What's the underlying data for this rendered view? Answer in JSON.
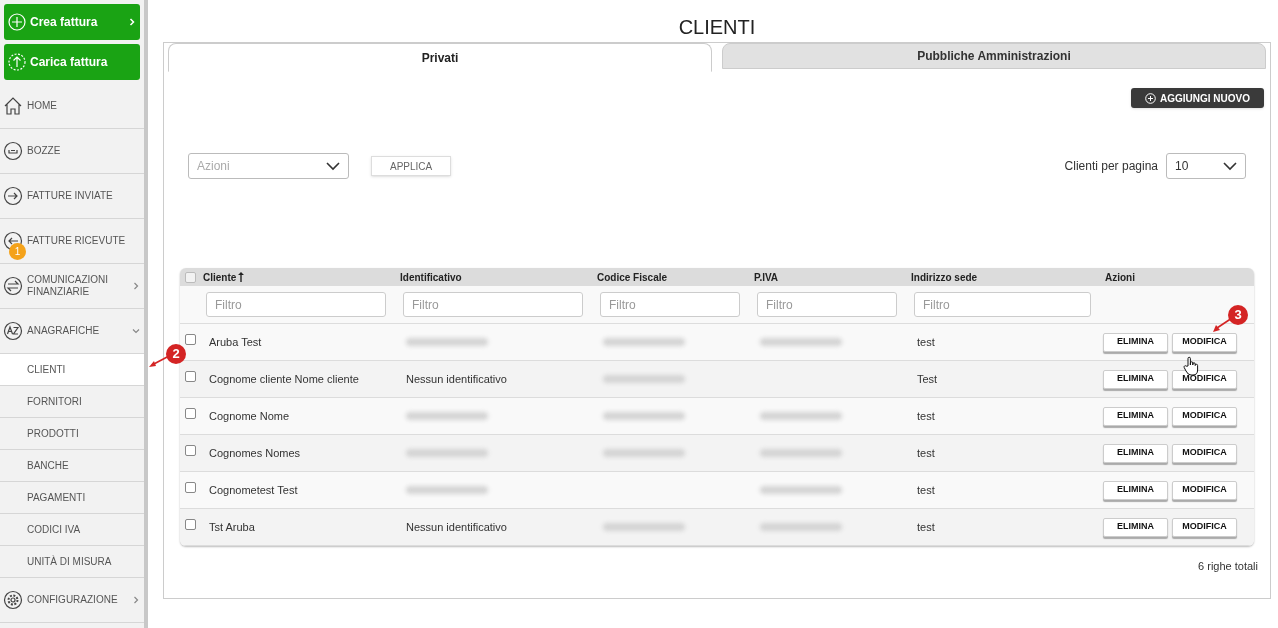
{
  "sidebar": {
    "actions": [
      {
        "label": "Crea fattura",
        "chevron": true
      },
      {
        "label": "Carica fattura",
        "chevron": false
      }
    ],
    "items": [
      {
        "label": "HOME"
      },
      {
        "label": "BOZZE"
      },
      {
        "label": "FATTURE INVIATE"
      },
      {
        "label": "FATTURE RICEVUTE",
        "badge": "1"
      },
      {
        "label": "COMUNICAZIONI FINANZIARIE",
        "expanded": false
      },
      {
        "label": "ANAGRAFICHE",
        "expanded": true,
        "children": [
          {
            "label": "CLIENTI",
            "selected": true
          },
          {
            "label": "FORNITORI",
            "selected": false
          },
          {
            "label": "PRODOTTI",
            "selected": false
          },
          {
            "label": "BANCHE",
            "selected": false
          },
          {
            "label": "PAGAMENTI",
            "selected": false
          },
          {
            "label": "CODICI IVA",
            "selected": false
          },
          {
            "label": "UNITÀ DI MISURA",
            "selected": false
          }
        ]
      },
      {
        "label": "CONFIGURAZIONE",
        "expanded": false
      }
    ]
  },
  "page": {
    "title": "CLIENTI",
    "tabs": [
      {
        "label": "Privati",
        "selected": true
      },
      {
        "label": "Pubbliche Amministrazioni",
        "selected": false
      }
    ],
    "add_button": "AGGIUNGI NUOVO",
    "bulk_action": {
      "placeholder": "Azioni"
    },
    "apply_button": "APPLICA",
    "per_page": {
      "label": "Clienti per pagina",
      "value": "10"
    },
    "table": {
      "all_checked": false,
      "columns": [
        {
          "label": "Cliente",
          "sorted": true,
          "placeholder": "Filtro"
        },
        {
          "label": "Identificativo",
          "sorted": false,
          "placeholder": "Filtro"
        },
        {
          "label": "Codice Fiscale",
          "sorted": false,
          "placeholder": "Filtro"
        },
        {
          "label": "P.IVA",
          "sorted": false,
          "placeholder": "Filtro"
        },
        {
          "label": "Indirizzo sede",
          "sorted": false,
          "placeholder": "Filtro"
        },
        {
          "label": "Azioni",
          "sorted": false
        }
      ],
      "rows": [
        {
          "checked": false,
          "cells": [
            {
              "text": "Aruba Test"
            },
            {
              "redacted": true
            },
            {
              "redacted": true
            },
            {
              "redacted": true
            },
            {
              "text": "test"
            }
          ],
          "delete": "ELIMINA",
          "edit": "MODIFICA"
        },
        {
          "checked": false,
          "cells": [
            {
              "text": "Cognome cliente Nome cliente"
            },
            {
              "text": "Nessun identificativo"
            },
            {
              "redacted": true
            },
            {
              "redacted": false
            },
            {
              "text": "Test"
            }
          ],
          "delete": "ELIMINA",
          "edit": "MODIFICA"
        },
        {
          "checked": false,
          "cells": [
            {
              "text": "Cognome Nome"
            },
            {
              "redacted": true
            },
            {
              "redacted": true
            },
            {
              "redacted": true
            },
            {
              "text": "test"
            }
          ],
          "delete": "ELIMINA",
          "edit": "MODIFICA"
        },
        {
          "checked": false,
          "cells": [
            {
              "text": "Cognomes Nomes"
            },
            {
              "redacted": true
            },
            {
              "redacted": true
            },
            {
              "redacted": true
            },
            {
              "text": "test"
            }
          ],
          "delete": "ELIMINA",
          "edit": "MODIFICA"
        },
        {
          "checked": false,
          "cells": [
            {
              "text": "Cognometest Test"
            },
            {
              "redacted": true
            },
            {
              "redacted": false
            },
            {
              "redacted": true
            },
            {
              "text": "test"
            }
          ],
          "delete": "ELIMINA",
          "edit": "MODIFICA"
        },
        {
          "checked": false,
          "cells": [
            {
              "text": "Tst Aruba"
            },
            {
              "text": "Nessun identificativo"
            },
            {
              "redacted": true
            },
            {
              "redacted": true
            },
            {
              "text": "test"
            }
          ],
          "delete": "ELIMINA",
          "edit": "MODIFICA"
        }
      ],
      "total": "6 righe totali"
    }
  },
  "annotations": [
    {
      "label": "2"
    },
    {
      "label": "3"
    }
  ]
}
